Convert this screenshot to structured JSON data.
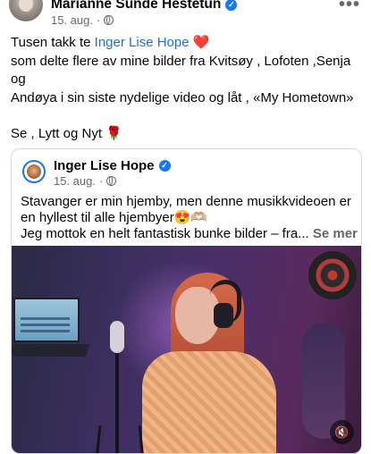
{
  "post": {
    "author": "Marianne Sunde Hestetun",
    "date": "15. aug.",
    "separator": "·",
    "more": "•••",
    "text_lines": {
      "line1_a": "Tusen takk te ",
      "line1_mention": "Inger Lise Hope",
      "line1_emoji": " ❤️",
      "line2": "som delte flere av mine bilder fra Kvitsøy , Lofoten ,Senja og",
      "line3": "Andøya  i sin siste nydelige video og låt ,  «My Hometown»",
      "line4_a": "Se , Lytt og Nyt ",
      "line4_emoji": "🌹",
      "hearts": "❤️❤️❤️"
    }
  },
  "shared_post": {
    "author": "Inger Lise Hope",
    "date": "15. aug.",
    "separator": "·",
    "text_line1": "Stavanger er min hjemby, men denne musikkvideoen er",
    "text_line2": "en hyllest til alle hjembyer😍🫶🏼",
    "text_line3": "Jeg mottok en helt fantastisk bunke bilder – fra...",
    "see_more": "Se mer",
    "mute_icon": "🔇"
  },
  "icons": {
    "verified": "✓"
  }
}
